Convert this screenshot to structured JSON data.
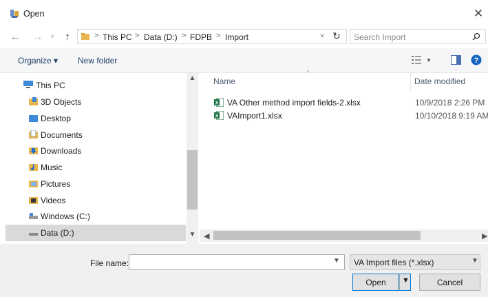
{
  "window": {
    "title": "Open",
    "close_glyph": "✕"
  },
  "nav": {
    "back": "←",
    "forward": "→",
    "recent": "˅",
    "up": "↑",
    "refresh": "↻",
    "dropdown": "˅"
  },
  "address": {
    "crumbs": [
      "This PC",
      "Data (D:)",
      "FDPB",
      "Import"
    ],
    "separator": ">",
    "leading_separator": ">"
  },
  "search": {
    "placeholder": "Search Import",
    "icon": "search-icon"
  },
  "toolbar": {
    "organize": "Organize ▾",
    "new_folder": "New folder"
  },
  "tree": [
    {
      "label": "This PC",
      "icon": "computer-icon"
    },
    {
      "label": "3D Objects",
      "icon": "3d-objects-icon"
    },
    {
      "label": "Desktop",
      "icon": "desktop-folder-icon"
    },
    {
      "label": "Documents",
      "icon": "documents-folder-icon"
    },
    {
      "label": "Downloads",
      "icon": "downloads-folder-icon"
    },
    {
      "label": "Music",
      "icon": "music-folder-icon"
    },
    {
      "label": "Pictures",
      "icon": "pictures-folder-icon"
    },
    {
      "label": "Videos",
      "icon": "videos-folder-icon"
    },
    {
      "label": "Windows (C:)",
      "icon": "drive-icon"
    },
    {
      "label": "Data (D:)",
      "icon": "drive-icon",
      "selected": true
    }
  ],
  "columns": {
    "name": "Name",
    "date_modified": "Date modified"
  },
  "files": [
    {
      "name": "VA Other method import fields-2.xlsx",
      "date": "10/9/2018 2:26 PM"
    },
    {
      "name": "VAImport1.xlsx",
      "date": "10/10/2018 9:19 AM"
    }
  ],
  "footer": {
    "file_name_label": "File name:",
    "file_name_value": "",
    "filter": "VA Import files (*.xlsx)",
    "open": "Open",
    "cancel": "Cancel"
  },
  "colors": {
    "accent": "#0078d7",
    "link": "#1f3b62",
    "excel_green": "#1d7044",
    "help_blue": "#1565c0"
  }
}
